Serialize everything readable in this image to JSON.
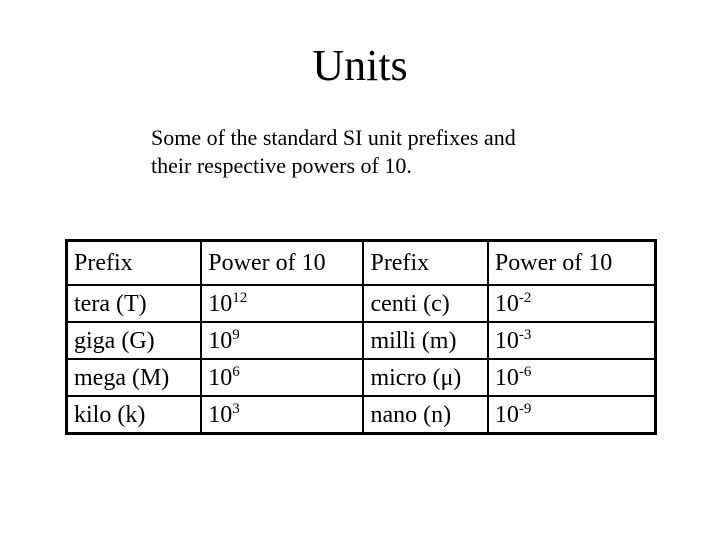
{
  "slide": {
    "title": "Units",
    "subtitle_line1": "Some of the standard SI unit prefixes and",
    "subtitle_line2": "their respective powers of 10."
  },
  "table": {
    "headers": [
      "Prefix",
      "Power of 10",
      "Prefix",
      "Power of 10"
    ],
    "rows": [
      {
        "prefix_large": "tera (T)",
        "base_large": "10",
        "exp_large": "12",
        "prefix_small": "centi (c)",
        "base_small": "10",
        "exp_small": "-2"
      },
      {
        "prefix_large": "giga (G)",
        "base_large": "10",
        "exp_large": "9",
        "prefix_small": "milli (m)",
        "base_small": "10",
        "exp_small": "-3"
      },
      {
        "prefix_large": "mega (M)",
        "base_large": "10",
        "exp_large": "6",
        "prefix_small": "micro (μ)",
        "base_small": "10",
        "exp_small": "-6"
      },
      {
        "prefix_large": "kilo (k)",
        "base_large": "10",
        "exp_large": "3",
        "prefix_small": "nano (n)",
        "base_small": "10",
        "exp_small": "-9"
      }
    ]
  }
}
